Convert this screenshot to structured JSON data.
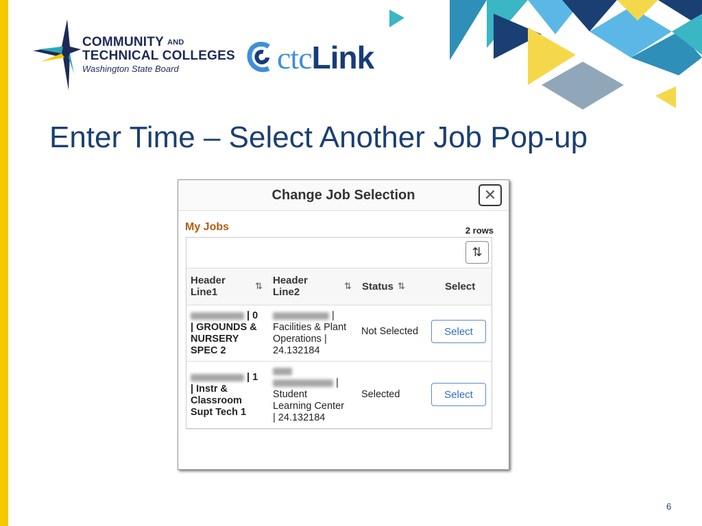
{
  "branding": {
    "sbctc_line1": "COMMUNITY",
    "sbctc_and": "AND",
    "sbctc_line2": "TECHNICAL COLLEGES",
    "sbctc_line3": "Washington State Board",
    "ctclink_ctc": "ctc",
    "ctclink_link": "Link"
  },
  "slide": {
    "title": "Enter Time – Select Another Job Pop-up",
    "page_number": "6"
  },
  "dialog": {
    "title": "Change Job Selection",
    "close_icon": "close-icon",
    "grid_title": "My Jobs",
    "row_count": "2 rows",
    "sort_icon": "sort-arrows-icon",
    "columns": {
      "header1_a": "Header",
      "header1_b": "Line1",
      "header2_a": "Header",
      "header2_b": "Line2",
      "status": "Status",
      "select": "Select"
    },
    "rows": [
      {
        "line1_suffix": "| 0",
        "line1_rest": [
          "| GROUNDS &",
          "NURSERY",
          "SPEC 2"
        ],
        "line2_suffix": "|",
        "line2_rest": [
          "Facilities & Plant",
          "Operations |",
          "24.132184"
        ],
        "status": "Not Selected",
        "button": "Select"
      },
      {
        "line1_suffix": "| 1",
        "line1_rest": [
          "| Instr &",
          "Classroom",
          "Supt Tech 1"
        ],
        "line2_suffix": "|",
        "line2_rest": [
          "Student",
          "Learning Center",
          "| 24.132184"
        ],
        "status": "Selected",
        "button": "Select"
      }
    ]
  },
  "colors": {
    "title": "#1a3f73",
    "accent_yellow": "#f5c800",
    "grid_title": "#b05c10",
    "button_text": "#2f6cc1"
  }
}
